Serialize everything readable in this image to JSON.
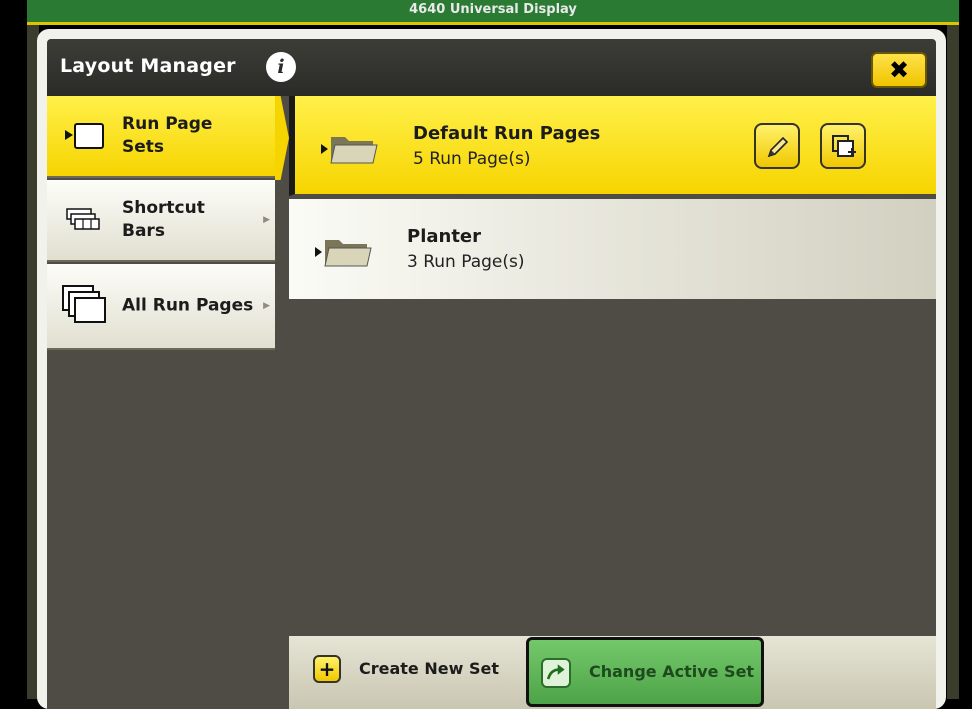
{
  "device_title": "4640 Universal Display",
  "window": {
    "title": "Layout Manager",
    "info_icon": "info-icon",
    "close_icon": "close-icon"
  },
  "sidebar": {
    "items": [
      {
        "label_line1": "Run Page",
        "label_line2": "Sets",
        "icon": "run-page-set-icon",
        "active": true
      },
      {
        "label_line1": "Shortcut",
        "label_line2": "Bars",
        "icon": "shortcut-bar-icon",
        "active": false
      },
      {
        "label": "All Run Pages",
        "icon": "stacked-pages-icon",
        "active": false
      }
    ]
  },
  "run_page_sets": [
    {
      "name": "Default Run Pages",
      "count": "5 Run Page(s)",
      "active": true
    },
    {
      "name": "Planter",
      "count": "3 Run Page(s)",
      "active": false
    }
  ],
  "actions": {
    "create": "Create New Set",
    "change": "Change Active Set"
  },
  "colors": {
    "accent_yellow": "#f6d400",
    "title_bar": "#2f2f2c",
    "content_bg": "#4e4c45",
    "green_button": "#5fb858",
    "top_bar_green": "#2b7a34"
  }
}
